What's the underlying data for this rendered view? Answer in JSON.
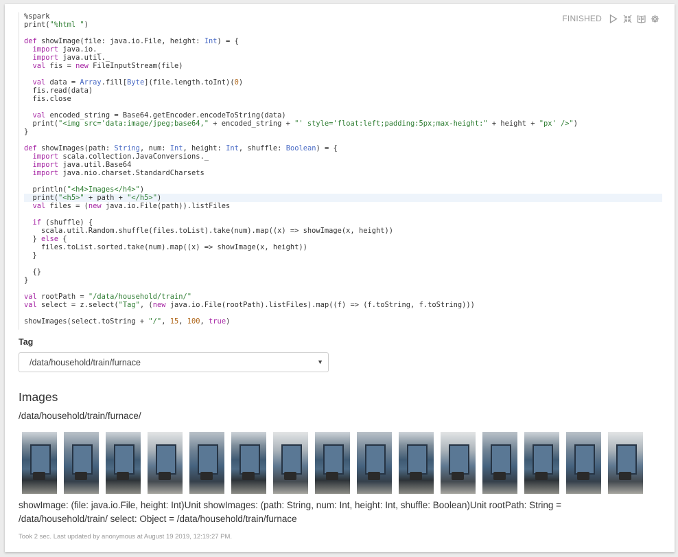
{
  "paragraph": {
    "status": "FINISHED",
    "controls": [
      "run-icon",
      "collapse-icon",
      "book-icon",
      "gear-icon"
    ]
  },
  "code_lines": [
    "%spark",
    "print(\"%html \")",
    "",
    "def showImage(file: java.io.File, height: Int) = {",
    "  import java.io._",
    "  import java.util._",
    "  val fis = new FileInputStream(file)",
    "",
    "  val data = Array.fill[Byte](file.length.toInt)(0)",
    "  fis.read(data)",
    "  fis.close",
    "",
    "  val encoded_string = Base64.getEncoder.encodeToString(data)",
    "  print(\"<img src='data:image/jpeg;base64,\" + encoded_string + \"' style='float:left;padding:5px;max-height:\" + height + \"px' />\")",
    "}",
    "",
    "def showImages(path: String, num: Int, height: Int, shuffle: Boolean) = {",
    "  import scala.collection.JavaConversions._",
    "  import java.util.Base64",
    "  import java.nio.charset.StandardCharsets",
    "",
    "  println(\"<h4>Images</h4>\")",
    "  print(\"<h5>\" + path + \"</h5>\")",
    "  val files = (new java.io.File(path)).listFiles",
    "",
    "  if (shuffle) {",
    "    scala.util.Random.shuffle(files.toList).take(num).map((x) => showImage(x, height))",
    "  } else {",
    "    files.toList.sorted.take(num).map((x) => showImage(x, height))",
    "  }",
    "",
    "  {}",
    "}",
    "",
    "val rootPath = \"/data/household/train/\"",
    "val select = z.select(\"Tag\", (new java.io.File(rootPath).listFiles).map((f) => (f.toString, f.toString)))",
    "",
    "showImages(select.toString + \"/\", 15, 100, true)"
  ],
  "active_line": 22,
  "form": {
    "label": "Tag",
    "select_value": "/data/household/train/furnace"
  },
  "output": {
    "heading": "Images",
    "path": "/data/household/train/furnace/",
    "image_count": 15,
    "result_text": "showImage: (file: java.io.File, height: Int)Unit showImages: (path: String, num: Int, height: Int, shuffle: Boolean)Unit rootPath: String = /data/household/train/ select: Object = /data/household/train/furnace"
  },
  "footer": "Took 2 sec. Last updated by anonymous at August 19 2019, 12:19:27 PM.",
  "colors": {
    "keyword": "#a626a4",
    "string": "#2e7d32",
    "type": "#4a6bc5",
    "number": "#b0671a",
    "active_line": "#eef4fb"
  }
}
